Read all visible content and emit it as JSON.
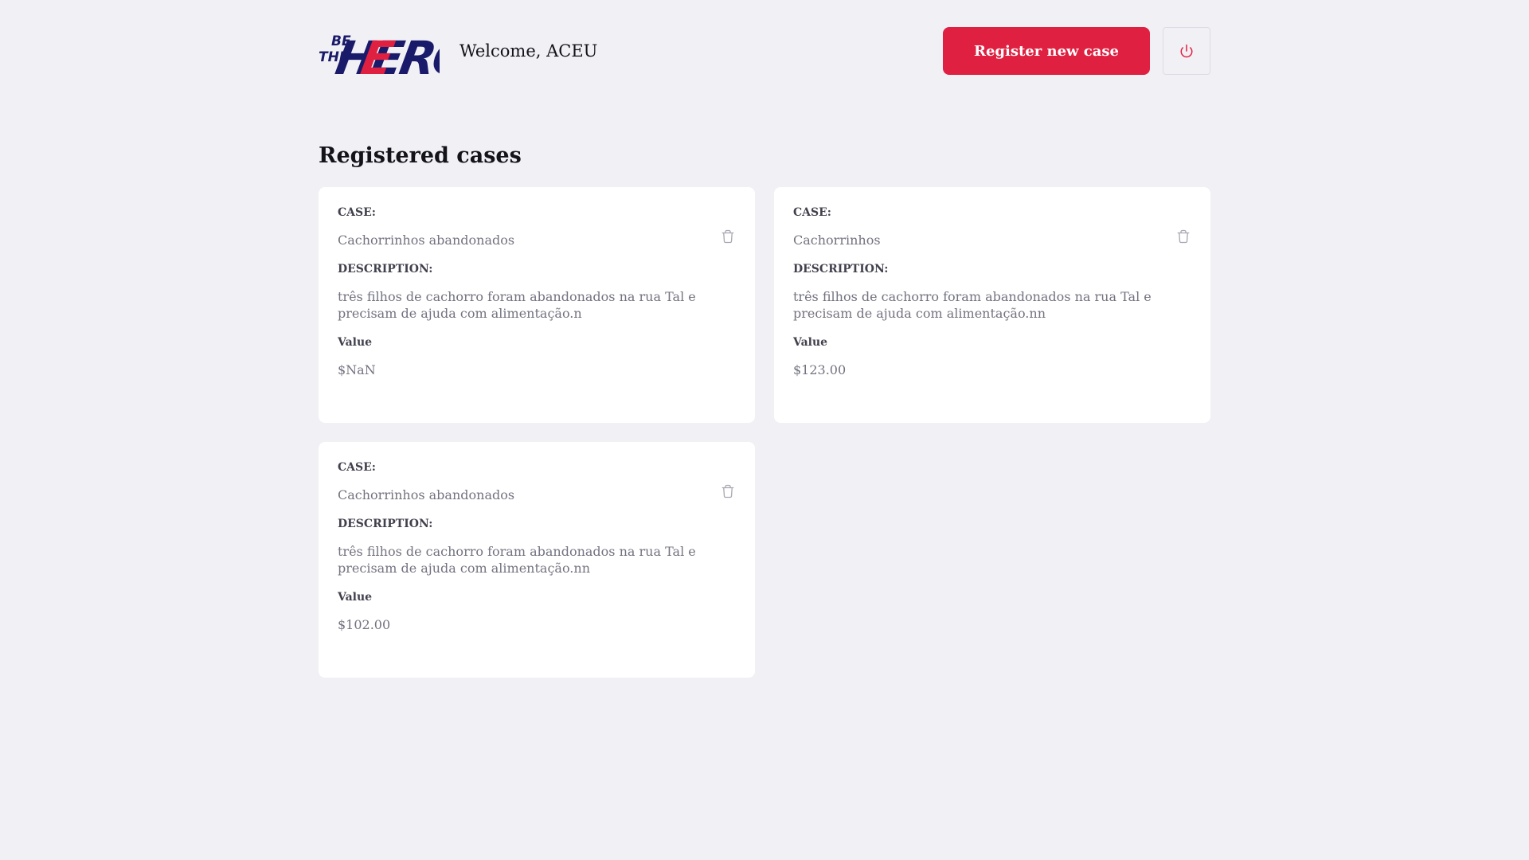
{
  "header": {
    "welcome": "Welcome, ACEU",
    "register_label": "Register new case",
    "logo_text_top": "BE",
    "logo_text_mid": "THE",
    "logo_text_main": "HERO",
    "logout_icon": "power-icon"
  },
  "page": {
    "title": "Registered cases"
  },
  "colors": {
    "accent": "#e02041",
    "background": "#f0f0f5",
    "logo_navy": "#1a1a6b"
  },
  "cases": [
    {
      "case_label": "CASE:",
      "title": "Cachorrinhos abandonados",
      "description_label": "DESCRIPTION:",
      "description": "três filhos de cachorro foram abandonados na rua Tal e precisam de ajuda com alimentação.n",
      "value_label": "Value",
      "value": "$NaN"
    },
    {
      "case_label": "CASE:",
      "title": "Cachorrinhos",
      "description_label": "DESCRIPTION:",
      "description": "três filhos de cachorro foram abandonados na rua Tal e precisam de ajuda com alimentação.nn",
      "value_label": "Value",
      "value": "$123.00"
    },
    {
      "case_label": "CASE:",
      "title": "Cachorrinhos abandonados",
      "description_label": "DESCRIPTION:",
      "description": "três filhos de cachorro foram abandonados na rua Tal e precisam de ajuda com alimentação.nn",
      "value_label": "Value",
      "value": "$102.00"
    }
  ]
}
